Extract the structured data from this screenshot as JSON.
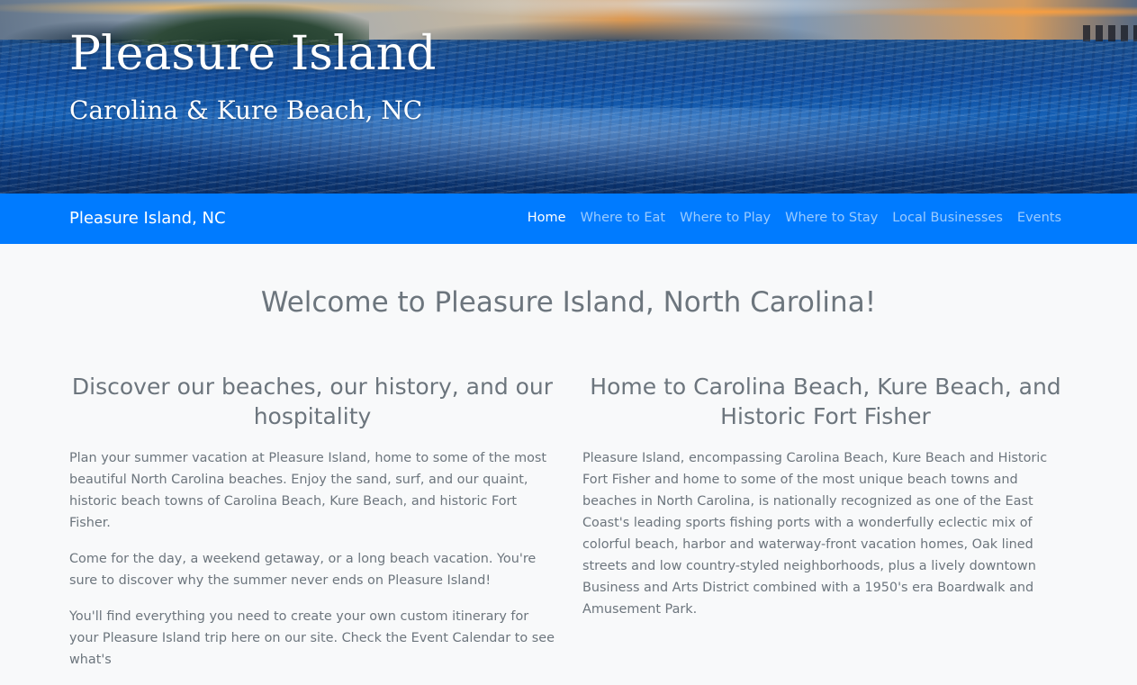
{
  "hero": {
    "title": "Pleasure Island",
    "subtitle": "Carolina & Kure Beach, NC"
  },
  "navbar": {
    "brand": "Pleasure Island, NC",
    "links": [
      {
        "label": "Home",
        "active": true
      },
      {
        "label": "Where to Eat",
        "active": false
      },
      {
        "label": "Where to Play",
        "active": false
      },
      {
        "label": "Where to Stay",
        "active": false
      },
      {
        "label": "Local Businesses",
        "active": false
      },
      {
        "label": "Events",
        "active": false
      }
    ],
    "bg_color": "#007bff"
  },
  "main": {
    "welcome_heading": "Welcome to Pleasure Island, North Carolina!",
    "left": {
      "heading": "Discover our beaches, our history, and our hospitality",
      "paragraphs": [
        "Plan your summer vacation at Pleasure Island, home to some of the most beautiful North Carolina beaches. Enjoy the sand, surf, and our quaint, historic beach towns of Carolina Beach, Kure Beach, and historic Fort Fisher.",
        "Come for the day, a weekend getaway, or a long beach vacation. You're sure to discover why the summer never ends on Pleasure Island!",
        "You'll find everything you need to create your own custom itinerary for your Pleasure Island trip here on our site. Check the Event Calendar to see what's"
      ]
    },
    "right": {
      "heading": "Home to Carolina Beach, Kure Beach, and Historic Fort Fisher",
      "paragraphs": [
        "Pleasure Island, encompassing Carolina Beach, Kure Beach and Historic Fort Fisher and home to some of the most unique beach towns and beaches in North Carolina, is nationally recognized as one of the East Coast's leading sports fishing ports with a wonderfully eclectic mix of colorful beach, harbor and waterway-front vacation homes, Oak lined streets and low country-styled neighborhoods, plus a lively downtown Business and Arts District combined with a 1950's era Boardwalk and Amusement Park."
      ]
    }
  }
}
